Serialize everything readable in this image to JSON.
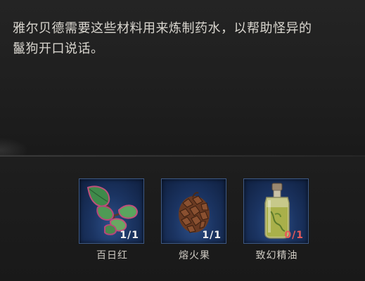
{
  "quest": {
    "description_line1": "雅尔贝德需要这些材料用来炼制药水，以帮助怪异的",
    "description_line2": "鬣狗开口说话。"
  },
  "materials": [
    {
      "name": "百日红",
      "count": "1/1",
      "icon": "leaf-plant-icon",
      "sufficient": true
    },
    {
      "name": "熔火果",
      "count": "1/1",
      "icon": "pinecone-fruit-icon",
      "sufficient": true
    },
    {
      "name": "致幻精油",
      "count": "0/1",
      "icon": "oil-bottle-icon",
      "sufficient": false
    }
  ],
  "colors": {
    "slot_border": "#3e5a86",
    "count_ok": "#f0f0f0",
    "count_lacking": "#e85a5a",
    "text": "#d9d6cf"
  }
}
